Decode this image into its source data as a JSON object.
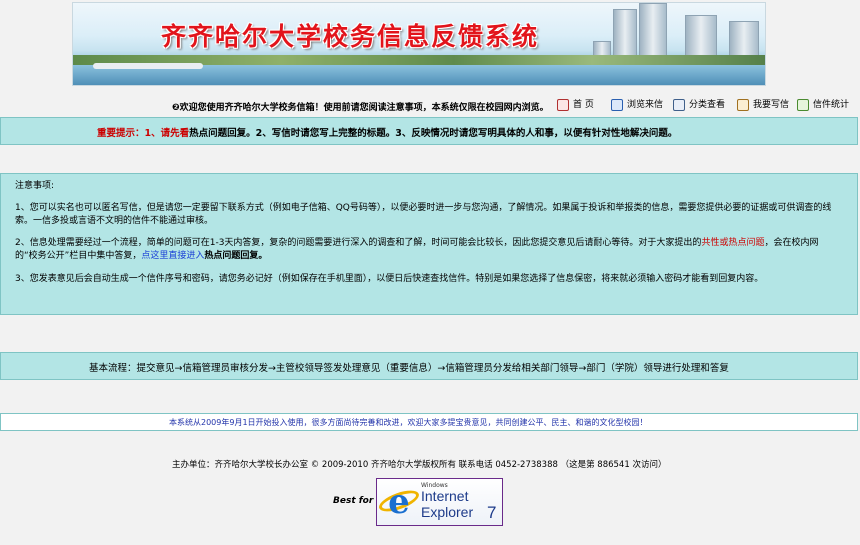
{
  "banner": {
    "title": "齐齐哈尔大学校务信息反馈系统"
  },
  "nav": {
    "welcome": "❷欢迎您使用齐齐哈尔大学校务信箱！使用前请您阅读注意事项，本系统仅限在校园网内浏览。",
    "items": [
      {
        "label": "首 页",
        "icon": "home-icon"
      },
      {
        "label": "浏览来信",
        "icon": "browse-letters-icon"
      },
      {
        "label": "分类查看",
        "icon": "category-icon"
      },
      {
        "label": "我要写信",
        "icon": "write-letter-icon"
      },
      {
        "label": "信件统计",
        "icon": "statistics-icon"
      }
    ]
  },
  "hint": {
    "prefix": "重要提示：1、请先看",
    "hot": "热点问题",
    "rest": "回复。2、写信时请您写上完整的标题。3、反映情况时请您写明具体的人和事，以便有针对性地解决问题。"
  },
  "notes": {
    "heading": "注意事项:",
    "p1": "1、您可以实名也可以匿名写信，但是请您一定要留下联系方式（例如电子信箱、QQ号码等），以便必要时进一步与您沟通，了解情况。如果属于投诉和举报类的信息，需要您提供必要的证据或可供调查的线索。一信多投或言语不文明的信件不能通过审核。",
    "p2_a": "2、信息处理需要经过一个流程，简单的问题可在1-3天内答复，复杂的问题需要进行深入的调查和了解，时间可能会比较长，因此您提交意见后请耐心等待。对于大家提出的",
    "p2_red": "共性或热点问题",
    "p2_b": "，会在校内网的“校务公开”栏目中集中答复，",
    "p2_link": "点这里直接进入",
    "p2_hot": "热点问题",
    "p2_c": "回复。",
    "p3": "3、您发表意见后会自动生成一个信件序号和密码，请您务必记好（例如保存在手机里面），以便日后快速查找信件。特别是如果您选择了信息保密，将来就必须输入密码才能看到回复内容。"
  },
  "flow": "基本流程：提交意见→信箱管理员审核分发→主管校领导签发处理意见（重要信息）→信箱管理员分发给相关部门领导→部门（学院）领导进行处理和答复",
  "notice": "本系统从2009年9月1日开始投入使用，很多方面尚待完善和改进，欢迎大家多提宝贵意见，共同创建公平、民主、和谐的文化型校园！",
  "footer": "主办单位：齐齐哈尔大学校长办公室  © 2009-2010 齐齐哈尔大学版权所有  联系电话 0452-2738388    （这是第 886541 次访问）",
  "best_for": "Best for",
  "ie_badge": {
    "windows": "Windows",
    "line1": "Internet",
    "line2": "Explorer",
    "version": "7"
  }
}
